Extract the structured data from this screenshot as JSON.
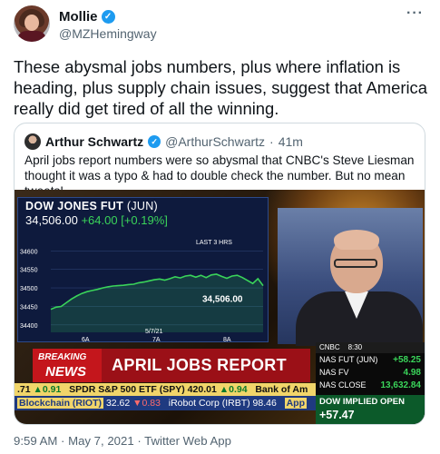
{
  "author": {
    "display_name": "Mollie",
    "handle": "@MZHemingway",
    "more_icon": "more-horizontal-icon"
  },
  "tweet": {
    "text": "These abysmal jobs numbers, plus where inflation is heading, plus supply chain issues, suggest that America really did get tired of all the winning."
  },
  "quote": {
    "display_name": "Arthur Schwartz",
    "handle": "@ArthurSchwartz",
    "separator": "·",
    "time": "41m",
    "text": "April jobs report numbers were so abysmal that CNBC's Steve Liesman thought it was a typo & had to double check the number. But no mean tweets!"
  },
  "tv": {
    "chart_title": "DOW JONES FUT",
    "chart_title_suffix": "(JUN)",
    "price": "34,506.00",
    "change": "+64.00",
    "change_pct": "[+0.19%]",
    "range_label": "LAST 3 HRS",
    "last_label": "34,506.00",
    "date_label": "5/7/21",
    "breaking_line1": "BREAKING",
    "breaking_line2": "NEWS",
    "headline": "APRIL JOBS REPORT",
    "network": "CNBC",
    "clock": "8:30",
    "markets": [
      {
        "label": "NAS FUT (JUN)",
        "value": "+58.25"
      },
      {
        "label": "NAS FV",
        "value": "4.98"
      },
      {
        "label": "NAS CLOSE",
        "value": "13,632.84"
      }
    ],
    "dow_implied_label": "DOW IMPLIED OPEN",
    "dow_implied_value": "+57.47",
    "ticker1": {
      "a": ".71",
      "b": "▲0.91",
      "c": "SPDR S&P 500 ETF (SPY)",
      "d": "420.01",
      "e": "▲0.94",
      "f": "Bank of Am"
    },
    "ticker2": {
      "a": "Blockchain (RIOT)",
      "b": "32.62",
      "c": "▼0.83",
      "d": "iRobot Corp (IRBT)",
      "e": "98.46",
      "f": "App"
    }
  },
  "chart_data": {
    "type": "line",
    "title": "DOW JONES FUT (JUN)",
    "x_ticks": [
      "6A",
      "7A",
      "8A"
    ],
    "y_ticks": [
      34600,
      34550,
      34500,
      34450,
      34400
    ],
    "ylim": [
      34380,
      34640
    ],
    "series": [
      {
        "values": [
          34442,
          34448,
          34450,
          34460,
          34470,
          34478,
          34485,
          34490,
          34493,
          34496,
          34500,
          34503,
          34505,
          34506,
          34507,
          34509,
          34510,
          34514,
          34516,
          34519,
          34522,
          34524,
          34521,
          34525,
          34530,
          34527,
          34532,
          34534,
          34529,
          34534,
          34528,
          34535,
          34537,
          34531,
          34526,
          34532,
          34534,
          34528,
          34520,
          34512,
          34525,
          34506
        ]
      }
    ],
    "last_value": 34506.0,
    "date_label": "5/7/21",
    "range_label": "LAST 3 HRS"
  },
  "footer": {
    "meta": "9:59 AM · May 7, 2021 · Twitter Web App"
  },
  "colors": {
    "verified": "#1d9bf0",
    "chart_line": "#3ad45a",
    "breaking_red": "#c4161c",
    "text_secondary": "#536471"
  }
}
